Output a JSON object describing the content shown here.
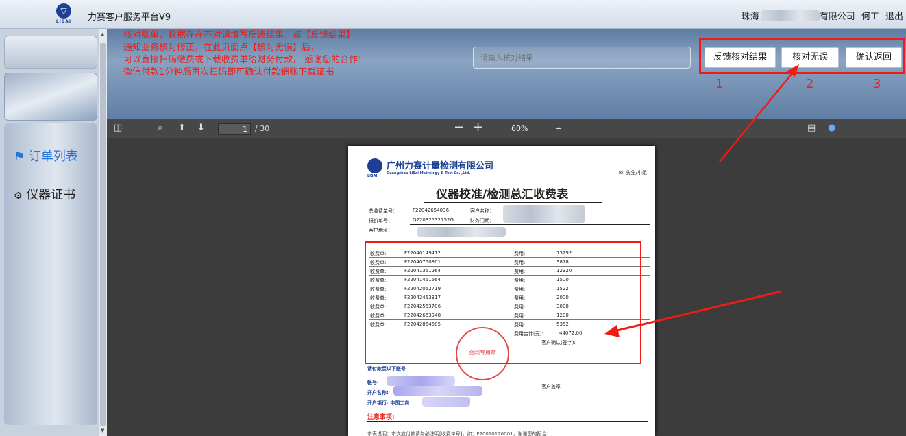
{
  "app": {
    "logo_text": "LISAI",
    "title": "力赛客户服务平台V9",
    "company_suffix": "有限公司",
    "company_prefix": "珠海",
    "user": "何工",
    "logout": "退出"
  },
  "sidebar": {
    "items": [
      {
        "label": "订单列表",
        "icon": "flag-icon",
        "active": true
      },
      {
        "label": "仪器证书",
        "icon": "gear-icon",
        "active": false
      }
    ]
  },
  "notice": {
    "lines": [
      "核对账单，数据存在不对请填写反馈结果，点【反馈结果】",
      "通知业务核对修正，在此页面点【核对无误】后，",
      "可以直接扫码缴费或下载收费单给财务付款，  感谢您的合作！",
      "微信付款1分钟后再次扫码即可确认付款销账下载证书"
    ]
  },
  "search": {
    "placeholder": "请输入核对结果"
  },
  "actions": {
    "feedback": "反馈核对结果",
    "confirm_ok": "核对无误",
    "back": "确认返回"
  },
  "annotations": {
    "labels": [
      "1",
      "2",
      "3"
    ],
    "color": "#f21a14"
  },
  "pdf_toolbar": {
    "page_current": "1",
    "page_total": "/ 30",
    "zoom": "60%",
    "zoom_minus": "−",
    "zoom_plus": "+"
  },
  "document": {
    "company_cn": "广州力赛计量检测有限公司",
    "company_en": "Guangzhou LiSai Metrology & Test Co. ,Ltd.",
    "to": "To:  先生/小姐",
    "title": "仪器校准/检测总汇收费表",
    "fields": {
      "total_no_label": "总收费单号：",
      "total_no": "F22042654036",
      "customer_name_label": "客户名称：",
      "quote_no_label": "报价单号：",
      "quote_no": "Q22032532752G",
      "dept_label": "财务门期：",
      "address_label": "客户地址："
    },
    "fees": [
      {
        "label": "收费单:",
        "no": "F22040149412",
        "fee_label": "费用:",
        "amount": "13292"
      },
      {
        "label": "收费单:",
        "no": "F22040750301",
        "fee_label": "费用:",
        "amount": "3878"
      },
      {
        "label": "收费单:",
        "no": "F22041351264",
        "fee_label": "费用:",
        "amount": "12320"
      },
      {
        "label": "收费单:",
        "no": "F22041451564",
        "fee_label": "费用:",
        "amount": "1500"
      },
      {
        "label": "收费单:",
        "no": "F22042052719",
        "fee_label": "费用:",
        "amount": "1522"
      },
      {
        "label": "收费单:",
        "no": "F22042453317",
        "fee_label": "费用:",
        "amount": "2000"
      },
      {
        "label": "收费单:",
        "no": "F22042553706",
        "fee_label": "费用:",
        "amount": "3008"
      },
      {
        "label": "收费单:",
        "no": "F22042653948",
        "fee_label": "费用:",
        "amount": "1200"
      },
      {
        "label": "收费单:",
        "no": "F22042854585",
        "fee_label": "费用:",
        "amount": "5352"
      }
    ],
    "total_label": "费用合计(元):",
    "total": "44072.00",
    "customer_confirm": "客户确认(签字):",
    "seal_text": "合同专用章",
    "bank_title": "请付款至以下账号",
    "account_label": "帐号:",
    "account_name_label": "开户名称:",
    "bank_label": "开户银行:   中国工商",
    "customer_stamp": "客户盖章",
    "notes_title": "注意事项:",
    "note_line": "本表说明：本次应付款请务必注明[收费单号]，如：F20010120001，谢谢您的配合！"
  }
}
